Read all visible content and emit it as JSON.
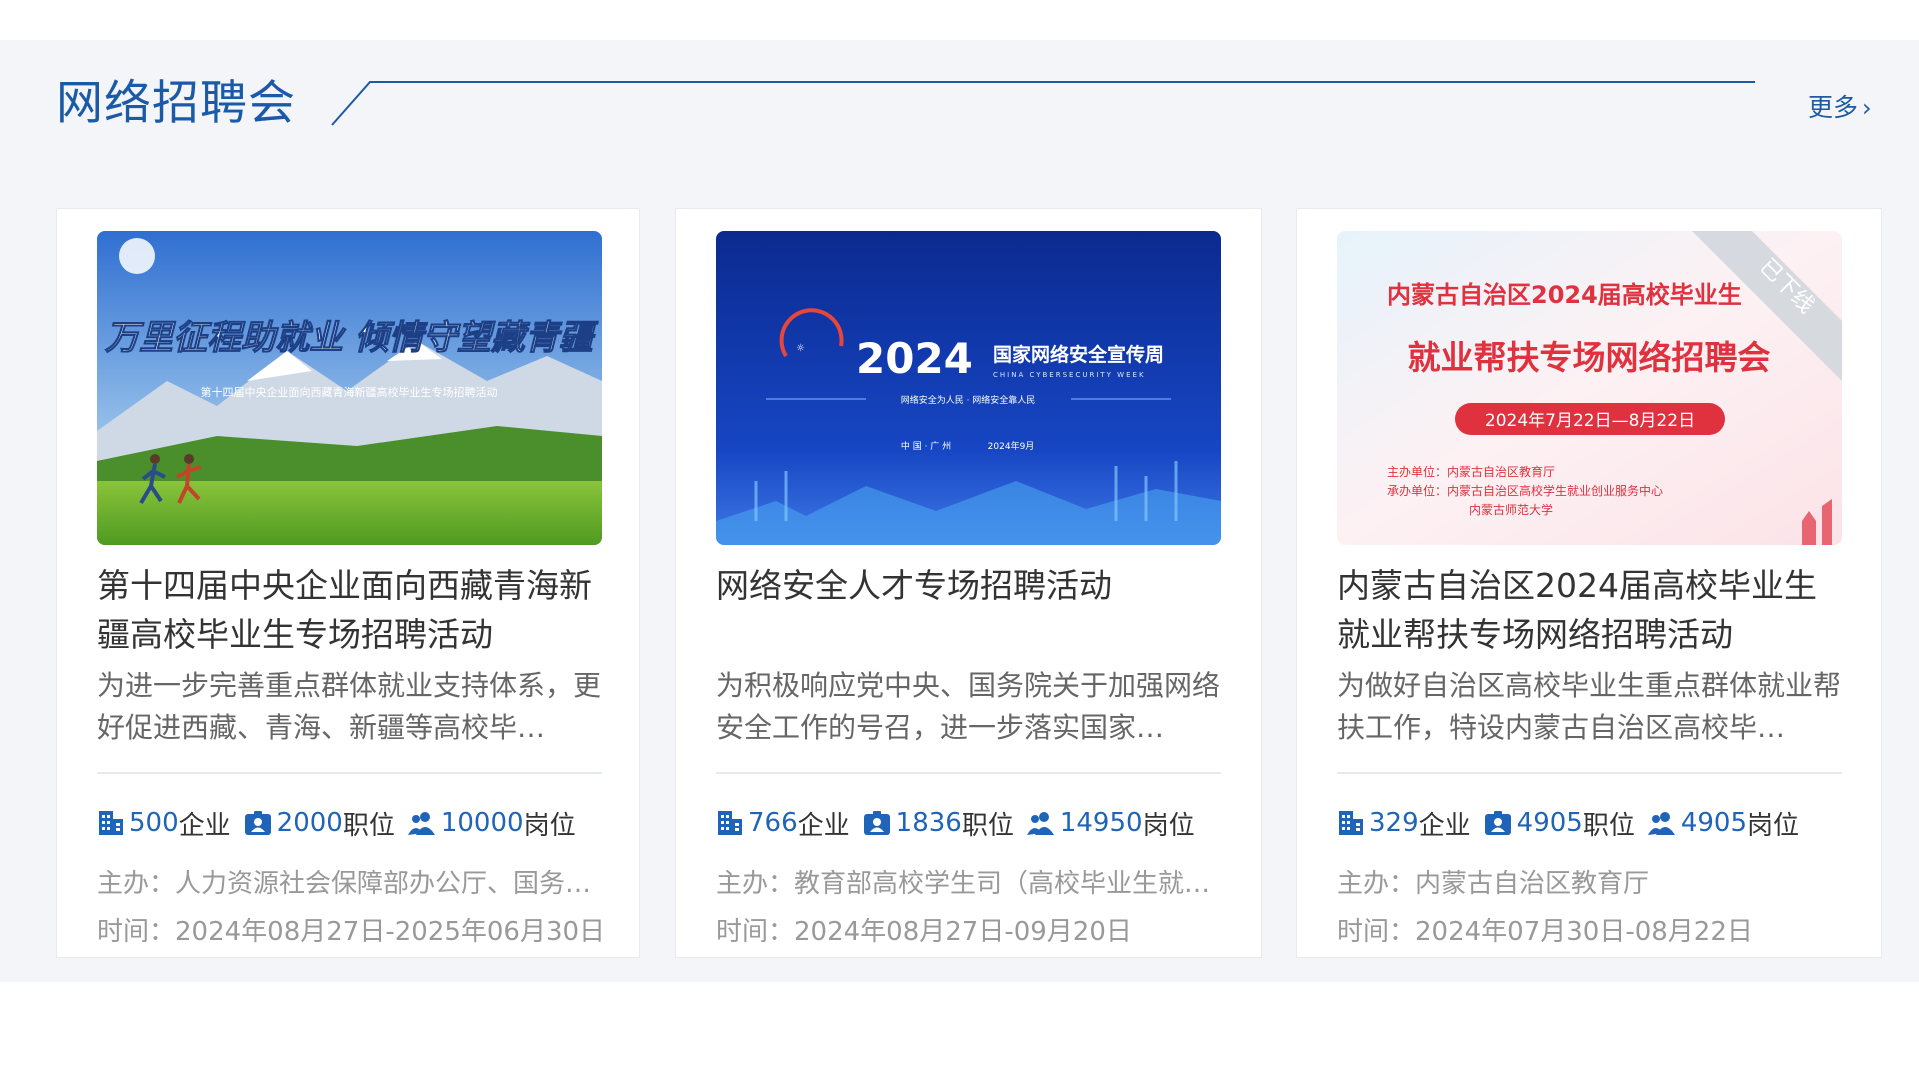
{
  "section": {
    "title": "网络招聘会",
    "more_label": "更多",
    "accent_color": "#1b5aa6"
  },
  "cards": [
    {
      "banner": {
        "headline": "万里征程助就业 倾情守望藏青疆",
        "subline": "第十四届中央企业面向西藏青海新疆高校毕业生专场招聘活动"
      },
      "title": "第十四届中央企业面向西藏青海新疆高校毕业生专场招聘活动",
      "description": "为进一步完善重点群体就业支持体系，更好促进西藏、青海、新疆等高校毕…",
      "stats": {
        "companies": "500",
        "companies_unit": "企业",
        "positions": "2000",
        "positions_unit": "职位",
        "openings": "10000",
        "openings_unit": "岗位"
      },
      "host": "主办：人力资源社会保障部办公厅、国务院…",
      "time": "时间：2024年08月27日-2025年06月30日"
    },
    {
      "banner": {
        "year": "2024",
        "headline": "国家网络安全宣传周",
        "english": "CHINA CYBERSECURITY WEEK",
        "slogan": "网络安全为人民 · 网络安全靠人民",
        "location": "中 国 · 广 州",
        "date": "2024年9月"
      },
      "title": "网络安全人才专场招聘活动",
      "description": "为积极响应党中央、国务院关于加强网络安全工作的号召，进一步落实国家…",
      "stats": {
        "companies": "766",
        "companies_unit": "企业",
        "positions": "1836",
        "positions_unit": "职位",
        "openings": "14950",
        "openings_unit": "岗位"
      },
      "host": "主办：教育部高校学生司（高校毕业生就业…",
      "time": "时间：2024年08月27日-09月20日"
    },
    {
      "banner": {
        "line1": "内蒙古自治区2024届高校毕业生",
        "line2": "就业帮扶专场网络招聘会",
        "date": "2024年7月22日—8月22日",
        "organizer": "主办单位：内蒙古自治区教育厅",
        "undertaker": "承办单位：内蒙古自治区高校学生就业创业服务中心",
        "undertaker2": "内蒙古师范大学",
        "ribbon": "已下线"
      },
      "title": "内蒙古自治区2024届高校毕业生就业帮扶专场网络招聘活动",
      "description": "为做好自治区高校毕业生重点群体就业帮扶工作，特设内蒙古自治区高校毕…",
      "stats": {
        "companies": "329",
        "companies_unit": "企业",
        "positions": "4905",
        "positions_unit": "职位",
        "openings": "4905",
        "openings_unit": "岗位"
      },
      "host": "主办：内蒙古自治区教育厅",
      "time": "时间：2024年07月30日-08月22日"
    }
  ]
}
